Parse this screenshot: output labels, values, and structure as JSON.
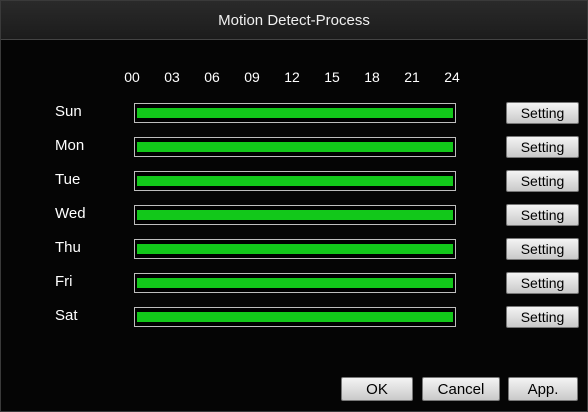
{
  "window": {
    "title": "Motion Detect-Process"
  },
  "hours": [
    "00",
    "03",
    "06",
    "09",
    "12",
    "15",
    "18",
    "21",
    "24"
  ],
  "days": [
    {
      "label": "Sun",
      "coverage": 1.0,
      "setting_label": "Setting"
    },
    {
      "label": "Mon",
      "coverage": 1.0,
      "setting_label": "Setting"
    },
    {
      "label": "Tue",
      "coverage": 1.0,
      "setting_label": "Setting"
    },
    {
      "label": "Wed",
      "coverage": 1.0,
      "setting_label": "Setting"
    },
    {
      "label": "Thu",
      "coverage": 1.0,
      "setting_label": "Setting"
    },
    {
      "label": "Fri",
      "coverage": 1.0,
      "setting_label": "Setting"
    },
    {
      "label": "Sat",
      "coverage": 1.0,
      "setting_label": "Setting"
    }
  ],
  "footer": {
    "ok_label": "OK",
    "cancel_label": "Cancel",
    "apply_label": "App."
  },
  "colors": {
    "schedule_fill": "#12c81a",
    "background": "#050505"
  }
}
